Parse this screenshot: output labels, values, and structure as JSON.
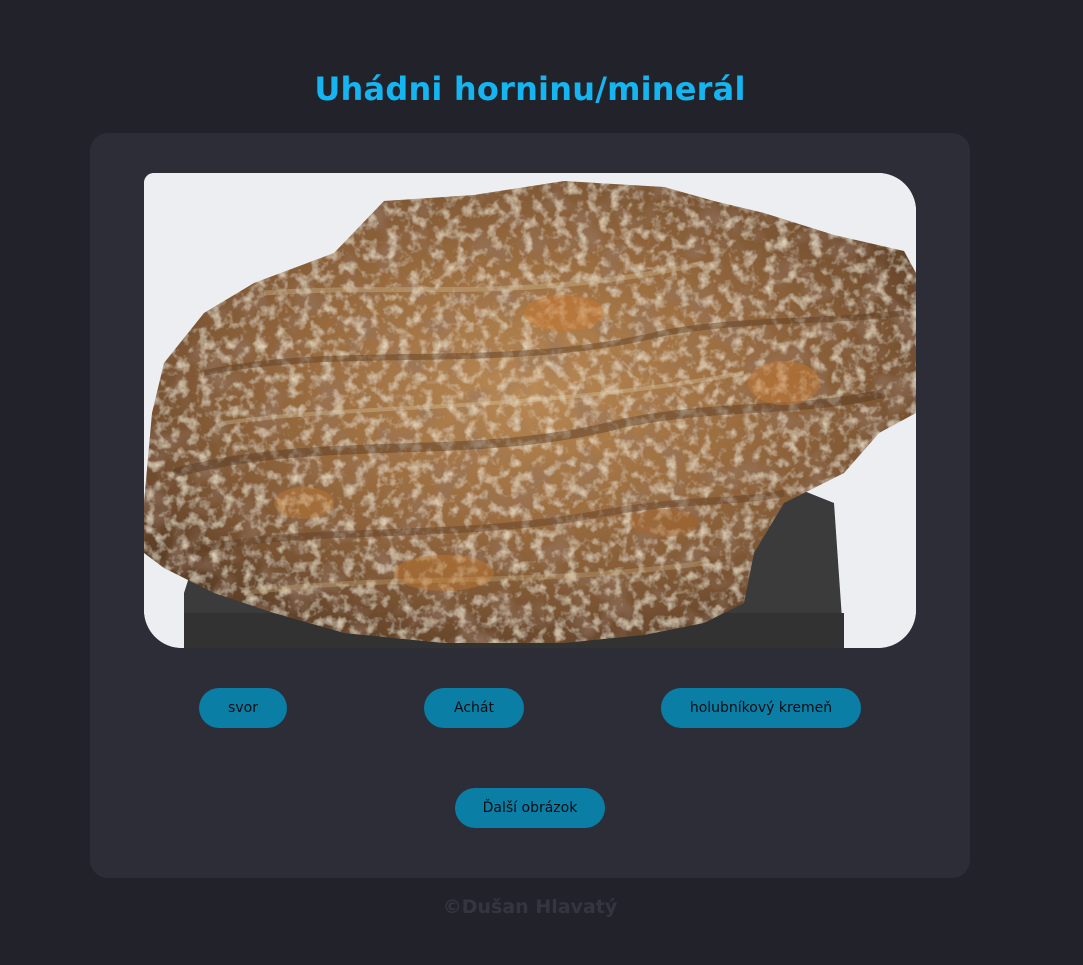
{
  "header": {
    "title": "Uhádni horninu/minerál"
  },
  "quiz": {
    "image_alt": "rock-specimen",
    "choices": [
      "svor",
      "Achát",
      "holubníkový kremeň"
    ],
    "next_label": "Ďalší obrázok"
  },
  "footer": {
    "copyright": "©Dušan Hlavatý"
  },
  "colors": {
    "background": "#22232a",
    "card": "#2c2d37",
    "accent": "#14b5f0",
    "button": "#0a7ea4"
  }
}
